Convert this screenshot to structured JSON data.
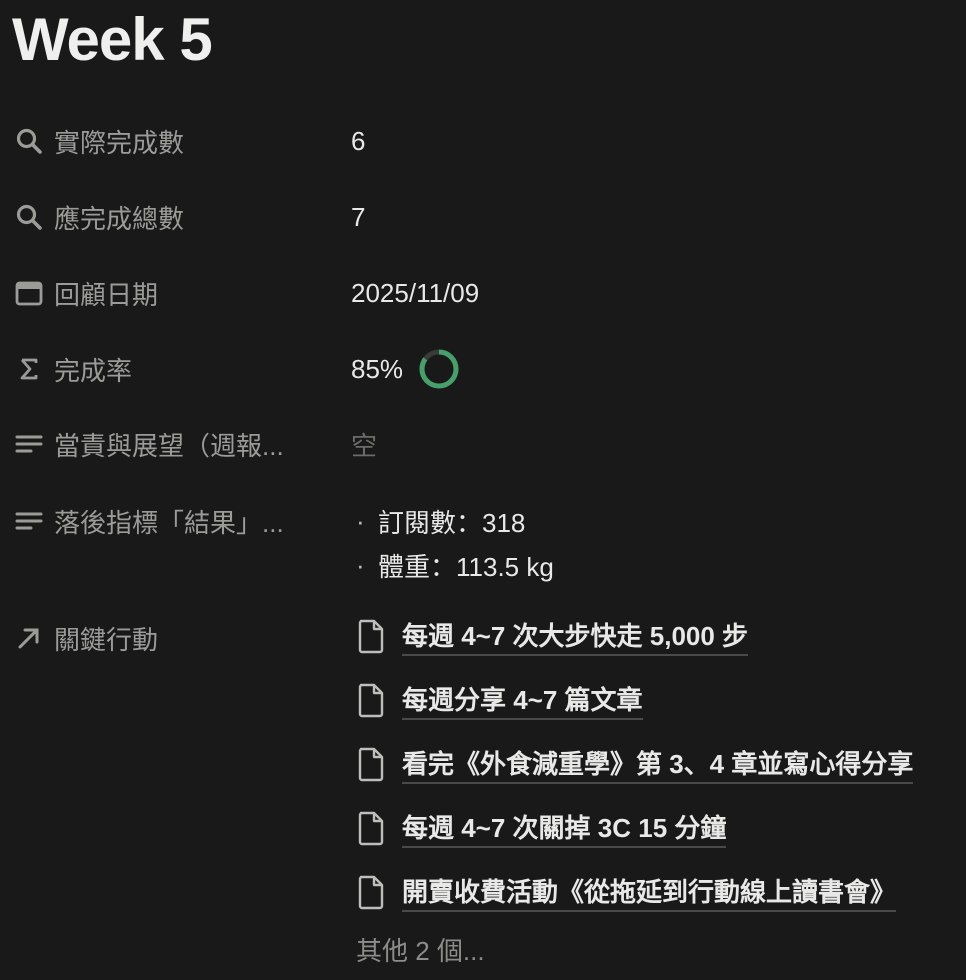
{
  "page": {
    "title": "Week 5"
  },
  "properties": {
    "actual": {
      "label": "實際完成數",
      "icon": "search-icon",
      "value": "6"
    },
    "total": {
      "label": "應完成總數",
      "icon": "search-icon",
      "value": "7"
    },
    "date": {
      "label": "回顧日期",
      "icon": "calendar-icon",
      "value": "2025/11/09"
    },
    "rate": {
      "label": "完成率",
      "icon": "sigma-icon",
      "value": "85%",
      "progress": 0.85,
      "ring_color": "#46a06b"
    },
    "reflection": {
      "label": "當責與展望（週報...",
      "icon": "text-lines-icon",
      "value": "空"
    },
    "lagging": {
      "label": "落後指標「結果」...",
      "icon": "text-lines-icon",
      "bullets": [
        "訂閱數：318",
        "體重：113.5 kg"
      ]
    },
    "actions": {
      "label": "關鍵行動",
      "icon": "arrow-up-right-icon",
      "items": [
        "每週 4~7 次大步快走 5,000 步",
        "每週分享 4~7 篇文章",
        "看完《外食減重學》第 3、4 章並寫心得分享",
        "每週 4~7 次關掉 3C 15 分鐘",
        "開賣收費活動《從拖延到行動線上讀書會》"
      ],
      "more": "其他 2 個..."
    }
  }
}
